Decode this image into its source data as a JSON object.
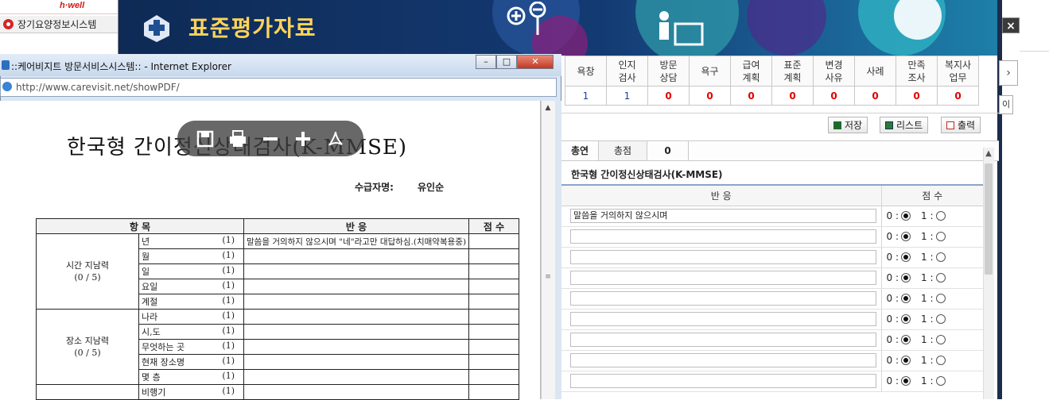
{
  "background": {
    "brand": "h·well",
    "ltc_tab_label": "장기요양정보시스템"
  },
  "eval_window": {
    "title": "표준평가자료",
    "close_label": "×",
    "counts_table": {
      "headers": [
        [
          "욕창",
          ""
        ],
        [
          "인지",
          "검사"
        ],
        [
          "방문",
          "상담"
        ],
        [
          "욕구",
          ""
        ],
        [
          "급여",
          "계획"
        ],
        [
          "표준",
          "계획"
        ],
        [
          "변경",
          "사유"
        ],
        [
          "사례",
          ""
        ],
        [
          "만족",
          "조사"
        ],
        [
          "복지사",
          "업무"
        ]
      ],
      "values": [
        "1",
        "1",
        "0",
        "0",
        "0",
        "0",
        "0",
        "0",
        "0",
        "0"
      ]
    },
    "tab_next": "›",
    "toolbar": {
      "save_label": "저장",
      "list_label": "리스트",
      "print_label": "출력"
    },
    "summary": {
      "left_label": "총연",
      "total_label": "총점",
      "total_value": "0"
    },
    "form_title": "한국형 간이정신상태검사(K-MMSE)",
    "form_table": {
      "header_response": "반 응",
      "header_score": "점 수",
      "rows": [
        {
          "response": "말씀을 거의하지 않으시며",
          "score0": "0 :",
          "score1": "1 :",
          "selected": 0
        },
        {
          "response": "",
          "score0": "0 :",
          "score1": "1 :",
          "selected": 0
        },
        {
          "response": "",
          "score0": "0 :",
          "score1": "1 :",
          "selected": 0
        },
        {
          "response": "",
          "score0": "0 :",
          "score1": "1 :",
          "selected": 0
        },
        {
          "response": "",
          "score0": "0 :",
          "score1": "1 :",
          "selected": 0
        },
        {
          "response": "",
          "score0": "0 :",
          "score1": "1 :",
          "selected": 0
        },
        {
          "response": "",
          "score0": "0 :",
          "score1": "1 :",
          "selected": 0
        },
        {
          "response": "",
          "score0": "0 :",
          "score1": "1 :",
          "selected": 0
        },
        {
          "response": "",
          "score0": "0 :",
          "score1": "1 :",
          "selected": 0
        }
      ]
    }
  },
  "ie_window": {
    "title": "::케어비지트 방문서비스시스템:: - Internet Explorer",
    "url": "http://www.carevisit.net/showPDF/",
    "minimize": "–",
    "maximize": "□",
    "close": "✕"
  },
  "pdf": {
    "doc_title": "한국형 간이정신상태검사(K-MMSE)",
    "recipient_label": "수급자명:",
    "recipient_name": "유인순",
    "table_headers": {
      "item": "항 목",
      "response": "반 응",
      "score": "점 수"
    },
    "time_group": {
      "label": "시간 지남력",
      "sub": "(0 / 5)",
      "items": [
        {
          "name": "년",
          "pts": "(1)",
          "response": "말씀을 거의하지 않으시며 \"네\"라고만 대답하심.(치매약복용중)"
        },
        {
          "name": "월",
          "pts": "(1)",
          "response": ""
        },
        {
          "name": "일",
          "pts": "(1)",
          "response": ""
        },
        {
          "name": "요일",
          "pts": "(1)",
          "response": ""
        },
        {
          "name": "계절",
          "pts": "(1)",
          "response": ""
        }
      ]
    },
    "place_group": {
      "label": "장소 지남력",
      "sub": "(0 / 5)",
      "items": [
        {
          "name": "나라",
          "pts": "(1)",
          "response": ""
        },
        {
          "name": "시,도",
          "pts": "(1)",
          "response": ""
        },
        {
          "name": "무엇하는 곳",
          "pts": "(1)",
          "response": ""
        },
        {
          "name": "현재 장소명",
          "pts": "(1)",
          "response": ""
        },
        {
          "name": "몇 층",
          "pts": "(1)",
          "response": ""
        }
      ]
    },
    "next_item": {
      "name": "비행기",
      "pts": "(1)"
    }
  },
  "colors": {
    "header_navy": "#143a73",
    "title_yellow": "#ffd45a",
    "count_red": "#e00000",
    "count_blue": "#1b3fa0"
  }
}
